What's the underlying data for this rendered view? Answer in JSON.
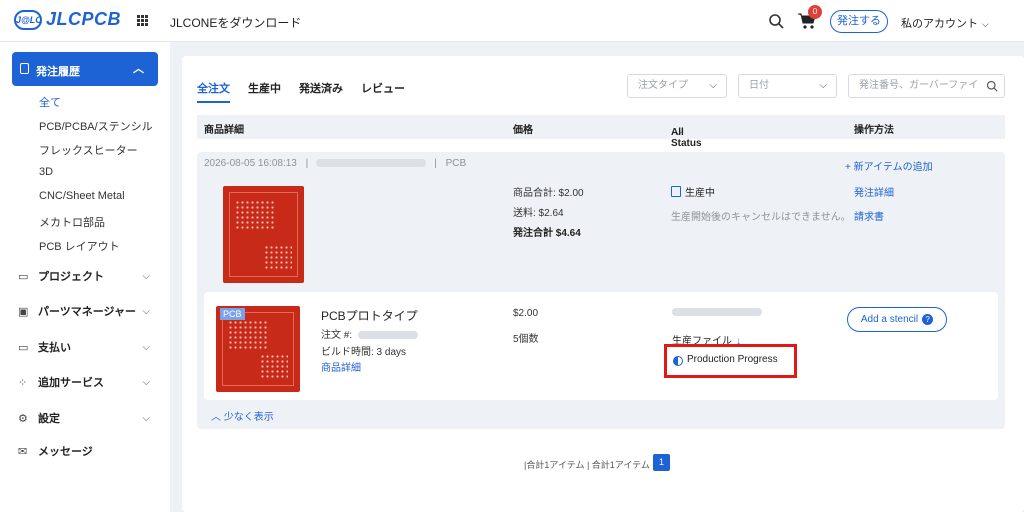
{
  "header": {
    "logo_badge": "J@LC",
    "logo_text": "JLCPCB",
    "download_link": "JLCONEをダウンロード",
    "cart_count": "0",
    "order_button": "発注する",
    "account_label": "私のアカウント"
  },
  "sidebar": {
    "active": {
      "label": "発注履歴"
    },
    "sub_items": [
      "全て",
      "PCB/PCBA/ステンシル",
      "フレックスヒーター",
      "3D",
      "CNC/Sheet Metal",
      "メカトロ部品",
      "PCB レイアウト"
    ],
    "items": [
      {
        "label": "プロジェクト",
        "icon": "folder-icon"
      },
      {
        "label": "パーツマネージャー",
        "icon": "chip-icon"
      },
      {
        "label": "支払い",
        "icon": "wallet-icon"
      },
      {
        "label": "追加サービス",
        "icon": "grid-icon"
      },
      {
        "label": "設定",
        "icon": "gear-icon"
      },
      {
        "label": "メッセージ",
        "icon": "mail-icon"
      }
    ]
  },
  "tabs": [
    "全注文",
    "生産中",
    "発送済み",
    "レビュー"
  ],
  "filters": {
    "order_type": "注文タイプ",
    "date": "日付",
    "search_placeholder": "発注番号、ガーバーファイ"
  },
  "table_headers": {
    "details": "商品詳細",
    "price": "価格",
    "status": "All Status",
    "actions": "操作方法"
  },
  "order": {
    "date": "2026-08-05 16:08:13",
    "category": "PCB",
    "add_item": "+ 新アイテムの追加",
    "subtotal": "商品合計: $2.00",
    "shipping": "送料: $2.64",
    "total": "発注合計 $4.64",
    "status": "生産中",
    "status_note": "生産開始後のキャンセルはできません。",
    "detail_link": "発注詳細",
    "invoice_link": "請求書"
  },
  "item": {
    "tag": "PCB",
    "title": "PCBプロトタイプ",
    "order_no_label": "注文 #:",
    "build_time": "ビルド時間:  3 days",
    "detail_link": "商品詳細",
    "price": "$2.00",
    "quantity": "5個数",
    "production_file": "生産ファイル",
    "production_progress": "Production Progress",
    "stencil_button": "Add a stencil"
  },
  "show_less": "少なく表示",
  "pagination": {
    "summary": "|合計1アイテム | 合計1アイテム",
    "current_page": "1"
  },
  "colors": {
    "accent": "#1d63d6",
    "highlight": "#e01818",
    "pcb": "#c72a18"
  }
}
